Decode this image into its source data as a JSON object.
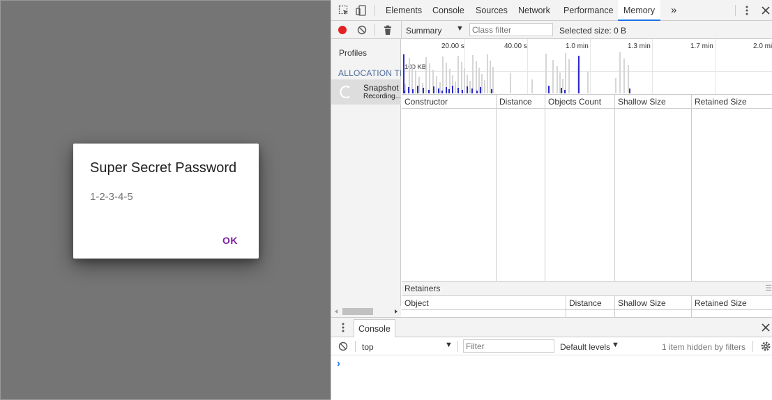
{
  "dialog": {
    "title": "Super Secret Password",
    "body": "1-2-3-4-5",
    "ok_label": "OK"
  },
  "devtools": {
    "tabs": [
      "Elements",
      "Console",
      "Sources",
      "Network",
      "Performance",
      "Memory"
    ],
    "active_tab": "Memory",
    "more_tabs_label": "»",
    "memory": {
      "view_select": "Summary",
      "class_filter_placeholder": "Class filter",
      "selected_size": "Selected size: 0 B",
      "sidebar": {
        "profiles_heading": "Profiles",
        "section_heading": "ALLOCATION TIMELINES",
        "snapshot_title": "Snapshot",
        "snapshot_status": "Recording..."
      },
      "timeline": {
        "ticks": [
          "20.00 s",
          "40.00 s",
          "1.0 min",
          "1.3 min",
          "1.7 min",
          "2.0 min"
        ],
        "size_label": "100 KB"
      },
      "table_columns": [
        "Constructor",
        "Distance",
        "Objects Count",
        "Shallow Size",
        "Retained Size"
      ],
      "retainers": {
        "title": "Retainers",
        "columns": [
          "Object",
          "Distance",
          "Shallow Size",
          "Retained Size"
        ]
      }
    },
    "drawer": {
      "tab_label": "Console",
      "context": "top",
      "filter_placeholder": "Filter",
      "levels": "Default levels",
      "hidden_info": "1 item hidden by filters",
      "prompt": "›"
    },
    "colors": {
      "accent": "#1a73e8",
      "record": "#e52222",
      "dialog_button": "#7b1fa2",
      "alloc_bar": "#2b2bc9"
    }
  }
}
